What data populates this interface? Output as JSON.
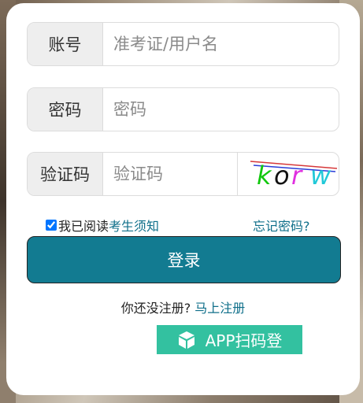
{
  "form": {
    "account": {
      "label": "账号",
      "placeholder": "准考证/用户名"
    },
    "password": {
      "label": "密码",
      "placeholder": "密码"
    },
    "captcha": {
      "label": "验证码",
      "placeholder": "验证码",
      "image_text": [
        "k",
        "o",
        "r",
        "w"
      ],
      "image_colors": [
        "#12c80e",
        "#111111",
        "#e030e0",
        "#21c9d8"
      ]
    },
    "agree": {
      "checked": true,
      "prefix": "我已阅读",
      "link": "考生须知"
    },
    "forgot_password": "忘记密码?",
    "login_button": "登录",
    "register_prompt": "你还没注册?",
    "register_link": "马上注册",
    "app_scan_button": "APP扫码登"
  },
  "colors": {
    "primary": "#127b91",
    "link": "#0f6f8a",
    "app_button": "#33c1a0"
  }
}
